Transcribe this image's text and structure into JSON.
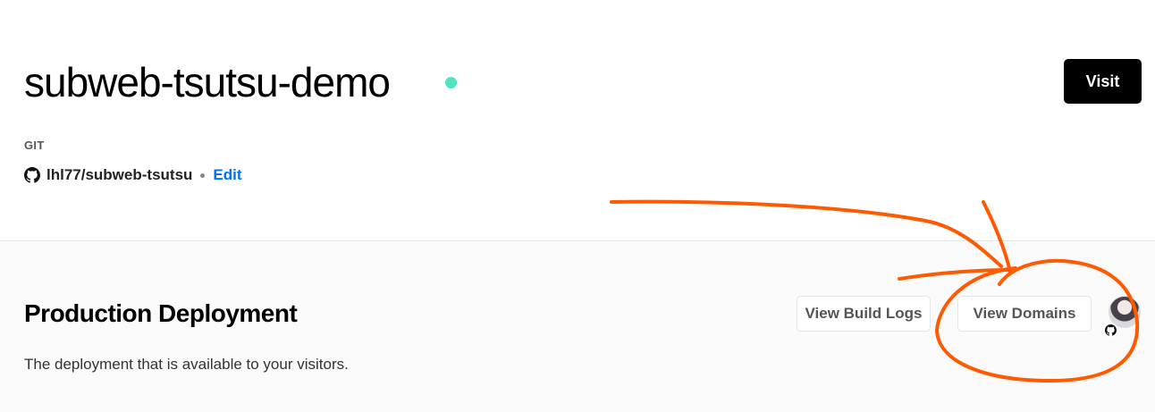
{
  "project": {
    "title": "subweb-tsutsu-demo",
    "status_color": "#50e3c2",
    "visit_label": "Visit"
  },
  "git": {
    "label": "GIT",
    "repo_icon": "github-icon",
    "repo": "lhl77/subweb-tsutsu",
    "edit_label": "Edit"
  },
  "production": {
    "title": "Production Deployment",
    "description": "The deployment that is available to your visitors.",
    "view_build_logs_label": "View Build Logs",
    "view_domains_label": "View Domains",
    "avatar_badge_icon": "github-icon"
  },
  "colors": {
    "accent_link": "#0070f3",
    "annotation": "#ff5a00"
  }
}
